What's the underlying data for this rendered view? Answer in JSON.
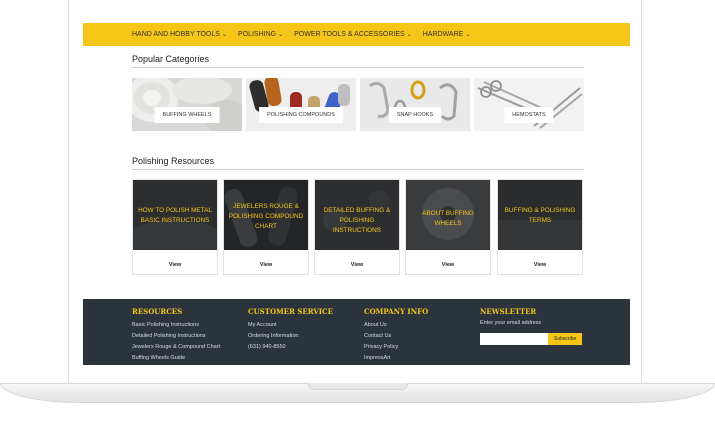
{
  "nav": {
    "items": [
      {
        "label": "Hand and Hobby Tools"
      },
      {
        "label": "Polishing"
      },
      {
        "label": "Power Tools & Accessories"
      },
      {
        "label": "Hardware"
      }
    ]
  },
  "popular": {
    "title": "Popular Categories",
    "items": [
      {
        "label": "Buffing Wheels"
      },
      {
        "label": "Polishing Compounds"
      },
      {
        "label": "Snap Hooks"
      },
      {
        "label": "Hemostats"
      }
    ]
  },
  "resources": {
    "title": "Polishing Resources",
    "items": [
      {
        "title": "How to Polish Metal Basic Instructions",
        "view": "View"
      },
      {
        "title": "Jewelers Rouge & Polishing Compound Chart",
        "view": "View"
      },
      {
        "title": "Detailed Buffing & Polishing Instructions",
        "view": "View"
      },
      {
        "title": "About Buffing Wheels",
        "view": "View"
      },
      {
        "title": "Buffing & Polishing Terms",
        "view": "View"
      }
    ]
  },
  "footer": {
    "resources": {
      "heading": "Resources",
      "links": [
        "Basic Polishing Instructions",
        "Detailed Polishing Instructions",
        "Jewelers Rouge & Compound Chart",
        "Buffing Wheels Guide"
      ]
    },
    "customer": {
      "heading": "Customer Service",
      "links": [
        "My Account",
        "Ordering Information",
        "(631) 940-8550"
      ]
    },
    "company": {
      "heading": "Company Info",
      "links": [
        "About Us",
        "Contact Us",
        "Privacy Policy",
        "ImpressArt"
      ]
    },
    "newsletter": {
      "heading": "Newsletter",
      "label": "Enter your email address",
      "button": "Subscribe"
    }
  },
  "colors": {
    "accent": "#f5c518",
    "footer_bg": "#2b343c"
  }
}
